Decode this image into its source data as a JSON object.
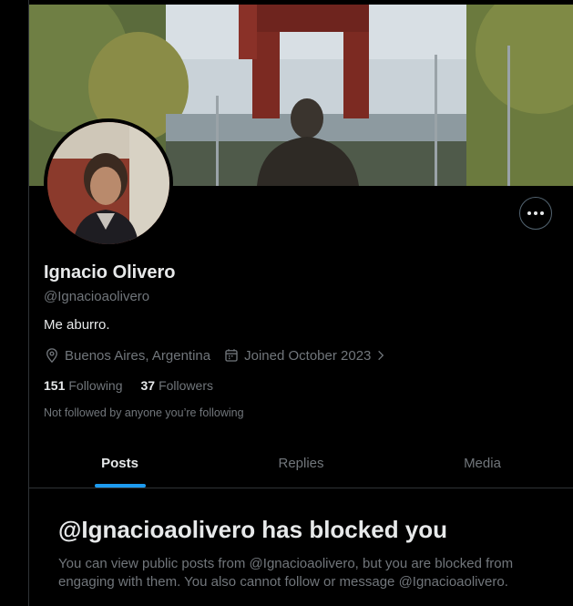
{
  "profile": {
    "name": "Ignacio Olivero",
    "handle": "@Ignacioaolivero",
    "bio": "Me aburro.",
    "location": "Buenos Aires, Argentina",
    "joined": "Joined October 2023",
    "following_count": "151",
    "following_label": "Following",
    "followers_count": "37",
    "followers_label": "Followers",
    "followed_note": "Not followed by anyone you’re following"
  },
  "tabs": [
    {
      "label": "Posts",
      "active": true
    },
    {
      "label": "Replies",
      "active": false
    },
    {
      "label": "Media",
      "active": false
    }
  ],
  "blocked": {
    "title": "@Ignacioaolivero has blocked you",
    "description": "You can view public posts from @Ignacioaolivero, but you are blocked from engaging with them. You also cannot follow or message @Ignacioaolivero."
  },
  "icons": {
    "location": "location-pin-icon",
    "calendar": "calendar-icon",
    "more": "more-options-icon"
  },
  "colors": {
    "accent": "#1d9bf0",
    "secondary_text": "#71767b",
    "primary_text": "#e7e9ea"
  }
}
